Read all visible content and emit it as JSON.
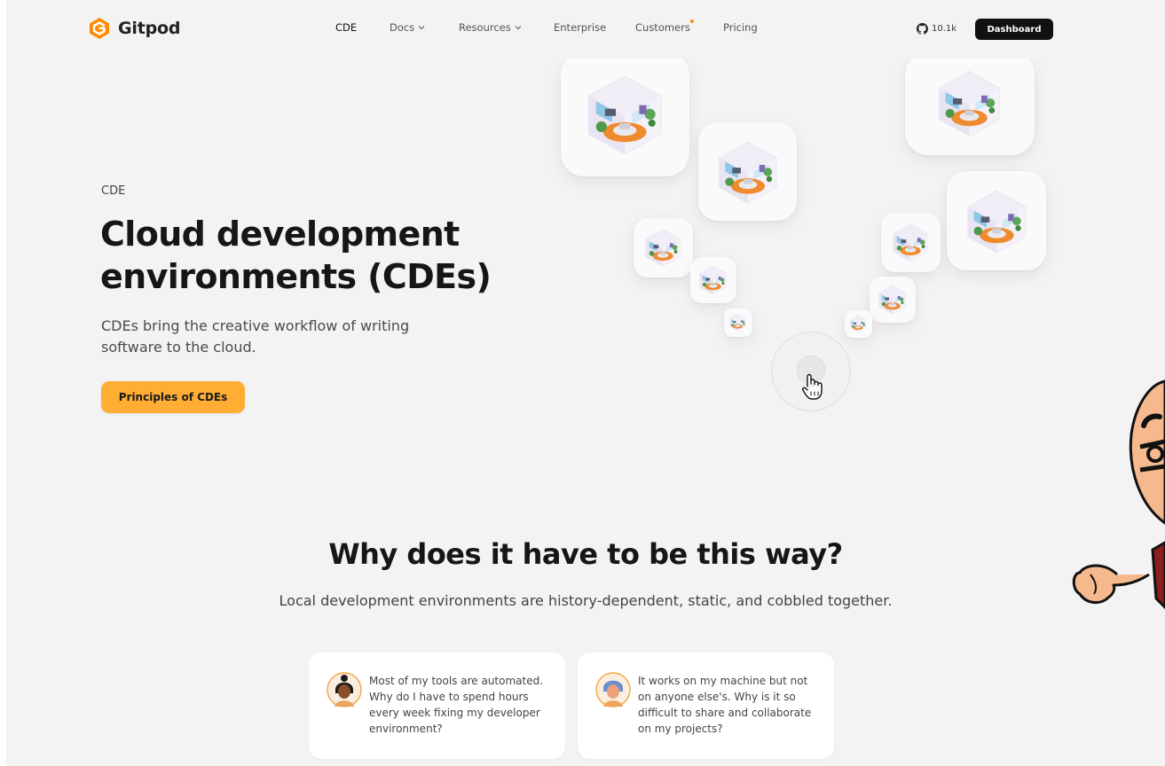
{
  "header": {
    "logo_text": "Gitpod",
    "nav": [
      {
        "label": "CDE",
        "dropdown": false,
        "active": true
      },
      {
        "label": "Docs",
        "dropdown": true
      },
      {
        "label": "Resources",
        "dropdown": true
      },
      {
        "label": "Enterprise",
        "dropdown": false
      },
      {
        "label": "Customers",
        "dropdown": false,
        "badge": true
      },
      {
        "label": "Pricing",
        "dropdown": false
      }
    ],
    "github_stars": "10.1k",
    "dashboard_label": "Dashboard"
  },
  "hero": {
    "eyebrow": "CDE",
    "title": "Cloud development environments (CDEs)",
    "subtitle": "CDEs bring the creative workflow of writing software to the cloud.",
    "cta_label": "Principles of CDEs"
  },
  "section": {
    "title": "Why does it have to be this way?",
    "subtitle": "Local development environments are history-dependent, static, and cobbled together."
  },
  "cards": [
    {
      "quote": "Most of my tools are automated. Why do I have to spend hours every week fixing my developer environment?"
    },
    {
      "quote": "It works on my machine but not on anyone else's. Why is it so difficult to share and collaborate on my projects?"
    }
  ],
  "colors": {
    "accent": "#ffae33",
    "brand_orange": "#ff8a00",
    "background": "#f3f3f3",
    "dark": "#111111"
  },
  "icons": [
    "gitpod-logo-icon",
    "chevron-down-icon",
    "github-icon",
    "room-illustration-icon",
    "pointer-hand-icon",
    "avatar-icon"
  ]
}
